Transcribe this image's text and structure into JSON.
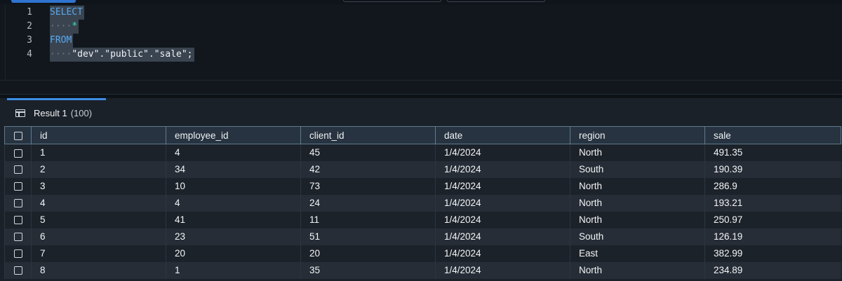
{
  "editor": {
    "lines": [
      {
        "num": "1",
        "text": "SELECT"
      },
      {
        "num": "2",
        "ws": "····",
        "text": "*"
      },
      {
        "num": "3",
        "text": "FROM"
      },
      {
        "num": "4",
        "ws": "····",
        "text": "\"dev\".\"public\".\"sale\";"
      }
    ]
  },
  "results": {
    "tab_label": "Result 1",
    "tab_count": "(100)",
    "columns": [
      "id",
      "employee_id",
      "client_id",
      "date",
      "region",
      "sale"
    ],
    "rows": [
      [
        "1",
        "4",
        "45",
        "1/4/2024",
        "North",
        "491.35"
      ],
      [
        "2",
        "34",
        "42",
        "1/4/2024",
        "South",
        "190.39"
      ],
      [
        "3",
        "10",
        "73",
        "1/4/2024",
        "North",
        "286.9"
      ],
      [
        "4",
        "4",
        "24",
        "1/4/2024",
        "North",
        "193.21"
      ],
      [
        "5",
        "41",
        "11",
        "1/4/2024",
        "North",
        "250.97"
      ],
      [
        "6",
        "23",
        "51",
        "1/4/2024",
        "South",
        "126.19"
      ],
      [
        "7",
        "20",
        "20",
        "1/4/2024",
        "East",
        "382.99"
      ],
      [
        "8",
        "1",
        "35",
        "1/4/2024",
        "North",
        "234.89"
      ]
    ]
  }
}
